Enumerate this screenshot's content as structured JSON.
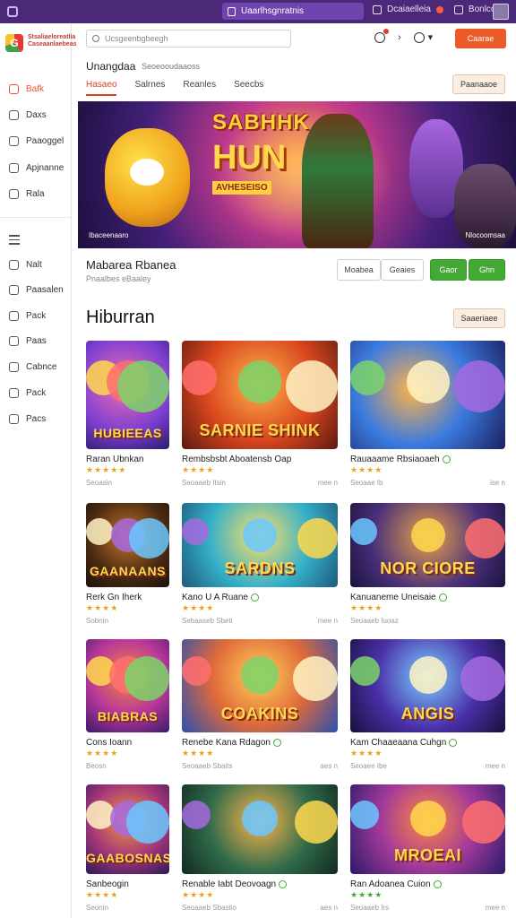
{
  "topbar": {
    "tab_label": "Uaarlhsgnratnis",
    "right_label1": "Dcaiaelleia",
    "right_label2": "Bonlco"
  },
  "sidebar": {
    "logo_text": "Stsaliaeloreatlia Caseaanlaebeas",
    "items_top": [
      {
        "label": "Bafk",
        "icon": "flame-icon",
        "active": true
      },
      {
        "label": "Daxs",
        "icon": "compass-icon"
      },
      {
        "label": "Paaoggel",
        "icon": "grid-icon"
      },
      {
        "label": "Apjnanne",
        "icon": "gamepad-icon"
      },
      {
        "label": "Rala",
        "icon": "cloud-icon"
      }
    ],
    "items_bottom": [
      {
        "label": "Nalt",
        "icon": "square-icon"
      },
      {
        "label": "Paasalen",
        "icon": "box-icon"
      },
      {
        "label": "Pack",
        "icon": "card-icon"
      },
      {
        "label": "Paas",
        "icon": "folder-icon"
      },
      {
        "label": "Cabnce",
        "icon": "settings-icon"
      },
      {
        "label": "Pack",
        "icon": "chat-icon"
      },
      {
        "label": "Pacs",
        "icon": "check-icon"
      }
    ]
  },
  "header": {
    "search_placeholder": "Ucsgeenbgbeegh",
    "cta_label": "Caarae"
  },
  "page": {
    "title": "Unangdaa",
    "subtitle": "Seoeooudaaoss",
    "tabs": [
      "Hasaeo",
      "Salrnes",
      "Reanles",
      "Seecbs"
    ],
    "action_label": "Paanaaoe"
  },
  "hero": {
    "logo_line1": "SABHHK",
    "logo_line2": "HUN",
    "logo_line3": "AVHESEISO",
    "caption_left": "Ibaceenaaro",
    "caption_right": "Nlocoomsaa"
  },
  "featured": {
    "title": "Mabarea Rbanea",
    "subtitle": "Pnaalbes eBaaley",
    "buttons": [
      "Moabea",
      "Geaies",
      "Gaor",
      "Ghn"
    ]
  },
  "section": {
    "title": "Hiburran",
    "action_label": "Saaeriaee"
  },
  "games": [
    {
      "title": "Raran Ubnkan",
      "overlay": "HUBIEEAS",
      "meta_left": "Seoasin",
      "meta_right": "",
      "stars": "★★★★★",
      "green_dot": false
    },
    {
      "title": "Rembsbsbt Aboatensb Oap",
      "overlay": "SARNIE SHINK",
      "meta_left": "Seoaaeb Itsin",
      "meta_right": "mee n",
      "stars": "★★★★",
      "green_dot": false
    },
    {
      "title": "Rauaaame Rbsiaoaeh",
      "overlay": "",
      "meta_left": "Seoaae Ib",
      "meta_right": "ise n",
      "stars": "★★★★",
      "green_dot": true
    },
    {
      "title": "Rerk Gn Iherk",
      "overlay": "GAANAANS",
      "meta_left": "Sobnin",
      "meta_right": "",
      "stars": "★★★★",
      "green_dot": false
    },
    {
      "title": "Kano U A Ruane",
      "overlay": "SARDNS",
      "meta_left": "Sebaaseb Sbeti",
      "meta_right": "mee n",
      "stars": "★★★★",
      "green_dot": true
    },
    {
      "title": "Kanuaneme Uneisaie",
      "overlay": "NOR CIORE",
      "meta_left": "Seoaaeb Iuoaz",
      "meta_right": "",
      "stars": "★★★★",
      "green_dot": true
    },
    {
      "title": "Cons Ioann",
      "overlay": "BIABRAS",
      "meta_left": "Beosn",
      "meta_right": "",
      "stars": "★★★★",
      "green_dot": false
    },
    {
      "title": "Renebe Kana Rdagon",
      "overlay": "COAKINS",
      "meta_left": "Seoaaeb Sbaits",
      "meta_right": "aes n",
      "stars": "★★★★",
      "green_dot": true
    },
    {
      "title": "Kam Chaaeaana Cuhgn",
      "overlay": "ANGIS",
      "meta_left": "Seoaee Ibe",
      "meta_right": "mee n",
      "stars": "★★★★",
      "green_dot": true
    },
    {
      "title": "Sanbeogin",
      "overlay": "GAABOSNAS",
      "meta_left": "Seonin",
      "meta_right": "",
      "stars": "★★★★",
      "green_dot": false
    },
    {
      "title": "Renable Iabt Deovoagn",
      "overlay": "",
      "meta_left": "Seoaaeb Sbastio",
      "meta_right": "aes n",
      "stars": "★★★★",
      "green_dot": true
    },
    {
      "title": "Ran Adoanea Cuion",
      "overlay": "MROEAI",
      "meta_left": "Seoaaeb Irs",
      "meta_right": "mee n",
      "stars": "★★★★",
      "green_dot": true
    }
  ],
  "colors": {
    "accent": "#ec5a27",
    "topbar": "#4a2a78",
    "green": "#43a935",
    "star": "#e9a21b"
  }
}
